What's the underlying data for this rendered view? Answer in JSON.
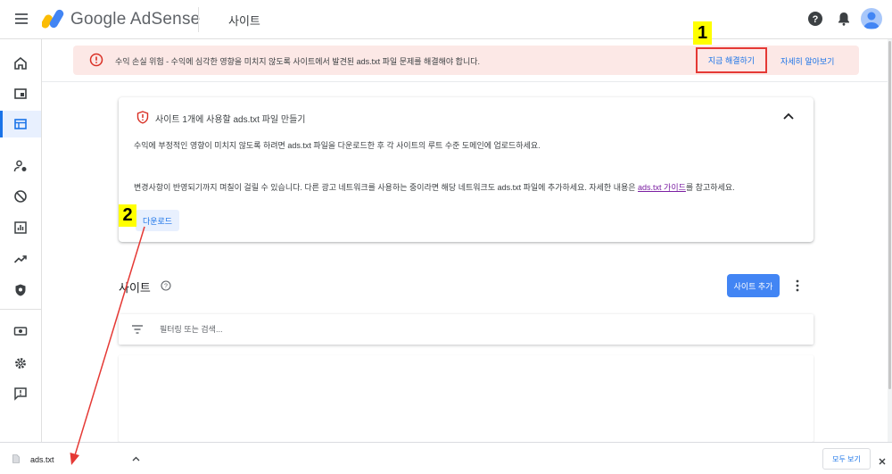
{
  "header": {
    "brand": "Google AdSense",
    "page_title": "사이트"
  },
  "sidebar": {
    "items": [
      {
        "name": "home",
        "icon": "home-icon"
      },
      {
        "name": "ads",
        "icon": "ads-icon"
      },
      {
        "name": "sites",
        "icon": "sites-icon",
        "active": true
      },
      {
        "name": "privacy-messaging",
        "icon": "person-icon"
      },
      {
        "name": "blocking-controls",
        "icon": "block-icon"
      },
      {
        "name": "reports",
        "icon": "bar-chart-icon"
      },
      {
        "name": "optimization",
        "icon": "trending-up-icon"
      },
      {
        "name": "policy-center",
        "icon": "shield-icon"
      },
      {
        "name": "payments",
        "icon": "payments-icon"
      },
      {
        "name": "account",
        "icon": "gear-icon"
      },
      {
        "name": "feedback",
        "icon": "feedback-icon"
      }
    ]
  },
  "alert": {
    "text": "수익 손실 위험 - 수익에 심각한 영향을 미치지 않도록 사이트에서 발견된 ads.txt 파일 문제를 해결해야 합니다.",
    "fix_now": "지금 해결하기",
    "learn_more": "자세히 알아보기"
  },
  "card": {
    "title": "사이트 1개에 사용할 ads.txt 파일 만들기",
    "paragraph1": "수익에 부정적인 영향이 미치지 않도록 하려면 ads.txt 파일을 다운로드한 후 각 사이트의 루트 수준 도메인에 업로드하세요.",
    "paragraph2_before": "변경사항이 반영되기까지 며칠이 걸릴 수 있습니다. 다른 광고 네트워크를 사용하는 중이라면 해당 네트워크도 ads.txt 파일에 추가하세요. 자세한 내용은 ",
    "paragraph2_link": "ads.txt 가이드",
    "paragraph2_after": "를 참고하세요.",
    "download": "다운로드"
  },
  "sites": {
    "title": "사이트",
    "add_site": "사이트 추가",
    "filter_placeholder": "필터링 또는 검색..."
  },
  "download_bar": {
    "file_name": "ads.txt",
    "show_all": "모두 보기"
  },
  "annotations": {
    "badge1": "1",
    "badge2": "2",
    "highlight_color": "#e53935",
    "badge_color": "#ffff00"
  },
  "colors": {
    "accent": "#1a73e8",
    "alert_bg": "#fce8e6",
    "alert_icon": "#d93025"
  }
}
